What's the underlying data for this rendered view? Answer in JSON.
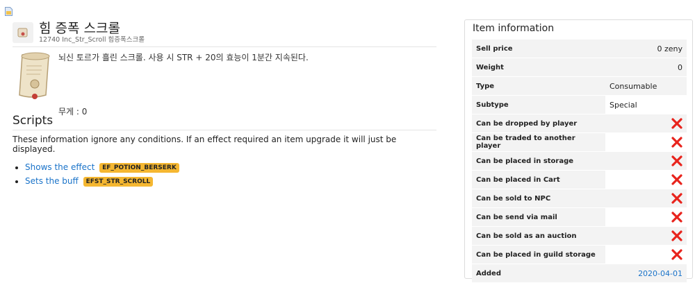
{
  "item": {
    "name": "힘 증폭 스크롤",
    "sub": "12740 Inc_Str_Scroll 힘증폭스크롤",
    "description": "뇌신 토르가 흘린 스크롤. 사용 시 STR + 20의 효능이 1분간 지속된다.",
    "weight_label": "무게 : ",
    "weight_value": "0"
  },
  "scripts": {
    "title": "Scripts",
    "info": "These information ignore any conditions. If an effect required an item upgrade it will just be displayed.",
    "items": [
      {
        "text": "Shows the effect",
        "tag": "EF_POTION_BERSERK"
      },
      {
        "text": "Sets the buff",
        "tag": "EFST_STR_SCROLL"
      }
    ]
  },
  "info_panel": {
    "title": "Item information",
    "rows": [
      {
        "key": "Sell price",
        "value": "0 zeny"
      },
      {
        "key": "Weight",
        "value": "0"
      },
      {
        "key": "Type",
        "value": "Consumable"
      },
      {
        "key": "Subtype",
        "value": "Special"
      },
      {
        "key": "Can be dropped by player",
        "flag": false
      },
      {
        "key": "Can be traded to another player",
        "flag": false
      },
      {
        "key": "Can be placed in storage",
        "flag": false
      },
      {
        "key": "Can be placed in Cart",
        "flag": false
      },
      {
        "key": "Can be sold to NPC",
        "flag": false
      },
      {
        "key": "Can be send via mail",
        "flag": false
      },
      {
        "key": "Can be sold as an auction",
        "flag": false
      },
      {
        "key": "Can be placed in guild storage",
        "flag": false
      },
      {
        "key": "Added",
        "value": "2020-04-01"
      }
    ]
  },
  "colors": {
    "link": "#1a73c9",
    "tag": "#f5b731",
    "x_mark": "#e8231c"
  }
}
